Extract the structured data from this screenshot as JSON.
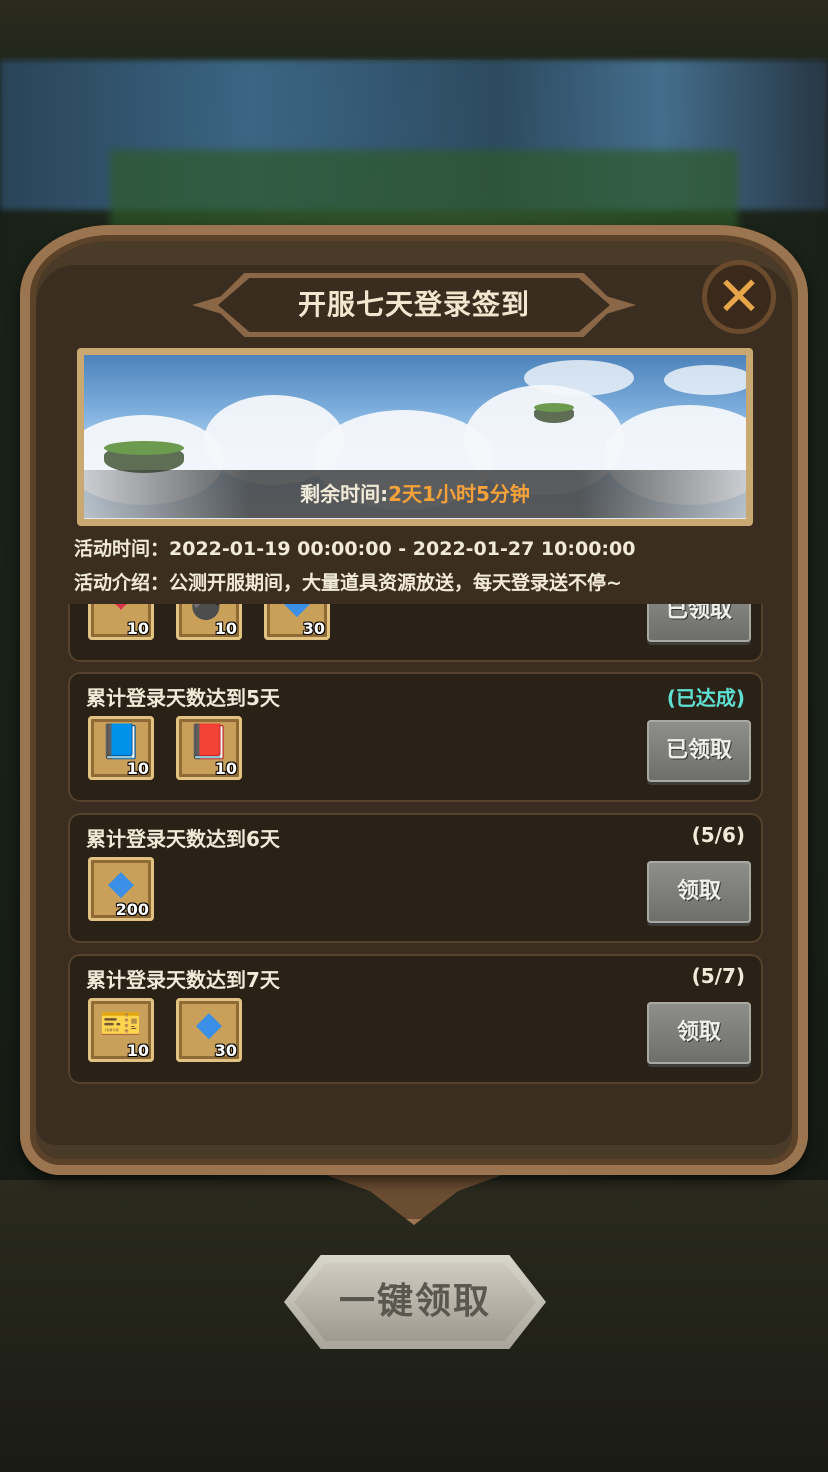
{
  "header": {
    "title": "开服七天登录签到"
  },
  "close": {
    "icon": "close-icon",
    "glyph": "✕"
  },
  "banner": {
    "timer_label": "剩余时间:",
    "timer_value": "2天1小时5分钟"
  },
  "info": {
    "time_line": "活动时间：2022-01-19 00:00:00 - 2022-01-27 10:00:00",
    "intro_line": "活动介绍：公测开服期间，大量道具资源放送，每天登录送不停~"
  },
  "tasks": [
    {
      "title": "",
      "progress": "",
      "items": [
        {
          "icon": "heart-potion-icon",
          "glyph": "❤",
          "count": "10"
        },
        {
          "icon": "bomb-icon",
          "glyph": "💣",
          "count": "10"
        },
        {
          "icon": "blue-gem-icon",
          "glyph": "◆",
          "count": "30"
        }
      ],
      "button": "已领取"
    },
    {
      "title": "累计登录天数达到5天",
      "progress": "(已达成)",
      "items": [
        {
          "icon": "blue-book-icon",
          "glyph": "📘",
          "count": "10"
        },
        {
          "icon": "purple-book-icon",
          "glyph": "📕",
          "count": "10"
        }
      ],
      "button": "已领取"
    },
    {
      "title": "累计登录天数达到6天",
      "progress": "(5/6)",
      "items": [
        {
          "icon": "blue-gem-icon",
          "glyph": "◆",
          "count": "200"
        }
      ],
      "button": "领取"
    },
    {
      "title": "累计登录天数达到7天",
      "progress": "(5/7)",
      "items": [
        {
          "icon": "gold-ticket-icon",
          "glyph": "🎫",
          "count": "10"
        },
        {
          "icon": "blue-gem-icon",
          "glyph": "◆",
          "count": "30"
        }
      ],
      "button": "领取"
    }
  ],
  "footer": {
    "claim_all": "一键领取"
  },
  "colors": {
    "accent": "#f5a13a",
    "done": "#5fe0d3",
    "panel": "#4a3a28"
  }
}
